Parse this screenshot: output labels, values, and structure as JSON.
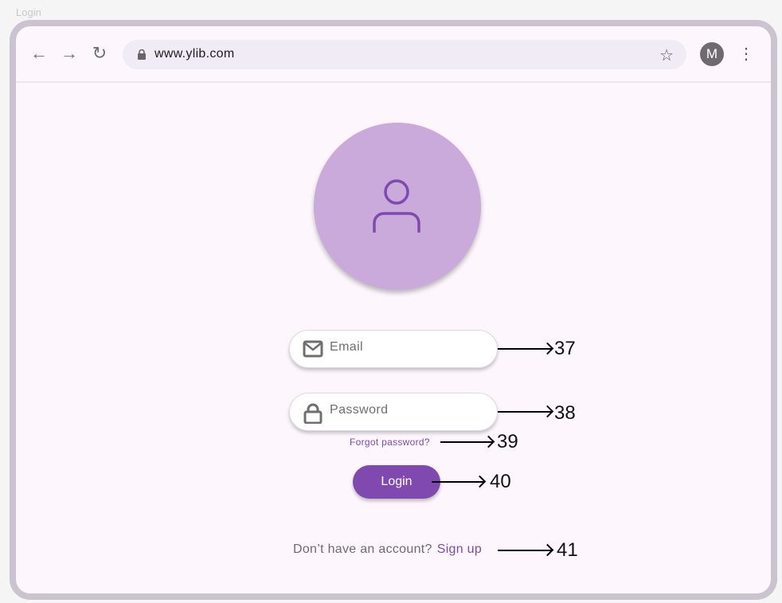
{
  "window_title": "Login",
  "browser": {
    "url": "www.ylib.com",
    "profile_initial": "M",
    "icons": [
      "back-arrow-icon",
      "forward-arrow-icon",
      "reload-icon",
      "lock-icon",
      "star-icon",
      "more-vert-icon"
    ]
  },
  "form": {
    "email_placeholder": "Email",
    "password_placeholder": "Password",
    "forgot_label": "Forgot password?",
    "login_label": "Login",
    "no_account_text": "Don’t have an account?",
    "signup_label": "Sign up"
  },
  "annotations": [
    "37",
    "38",
    "39",
    "40",
    "41"
  ],
  "colors": {
    "accent": "#8049b0",
    "avatar_bg": "#c9aadb",
    "page_bg": "#fdf7fd"
  }
}
